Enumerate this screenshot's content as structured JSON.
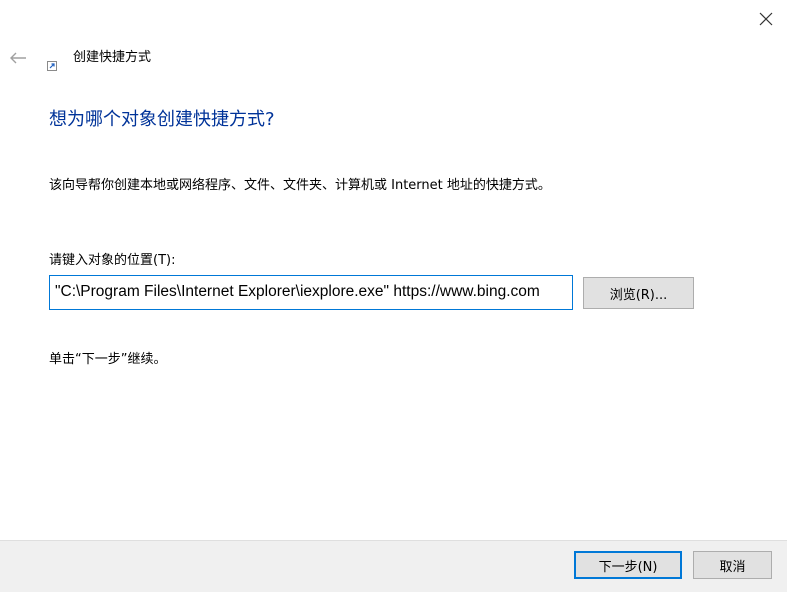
{
  "wizard": {
    "title": "创建快捷方式",
    "heading": "想为哪个对象创建快捷方式?",
    "description": "该向导帮你创建本地或网络程序、文件、文件夹、计算机或 Internet 地址的快捷方式。",
    "location_label": "请键入对象的位置(T):",
    "location_value": "\"C:\\Program Files\\Internet Explorer\\iexplore.exe\" https://www.bing.com",
    "browse_label": "浏览(R)...",
    "hint": "单击“下一步”继续。"
  },
  "footer": {
    "next_label": "下一步(N)",
    "cancel_label": "取消"
  },
  "icons": {
    "close": "close-icon",
    "back": "back-arrow-icon",
    "title": "shortcut-icon"
  },
  "colors": {
    "heading": "#003399",
    "focus_border": "#0078d7",
    "button_bg": "#e1e1e1",
    "footer_bg": "#f0f0f0"
  }
}
